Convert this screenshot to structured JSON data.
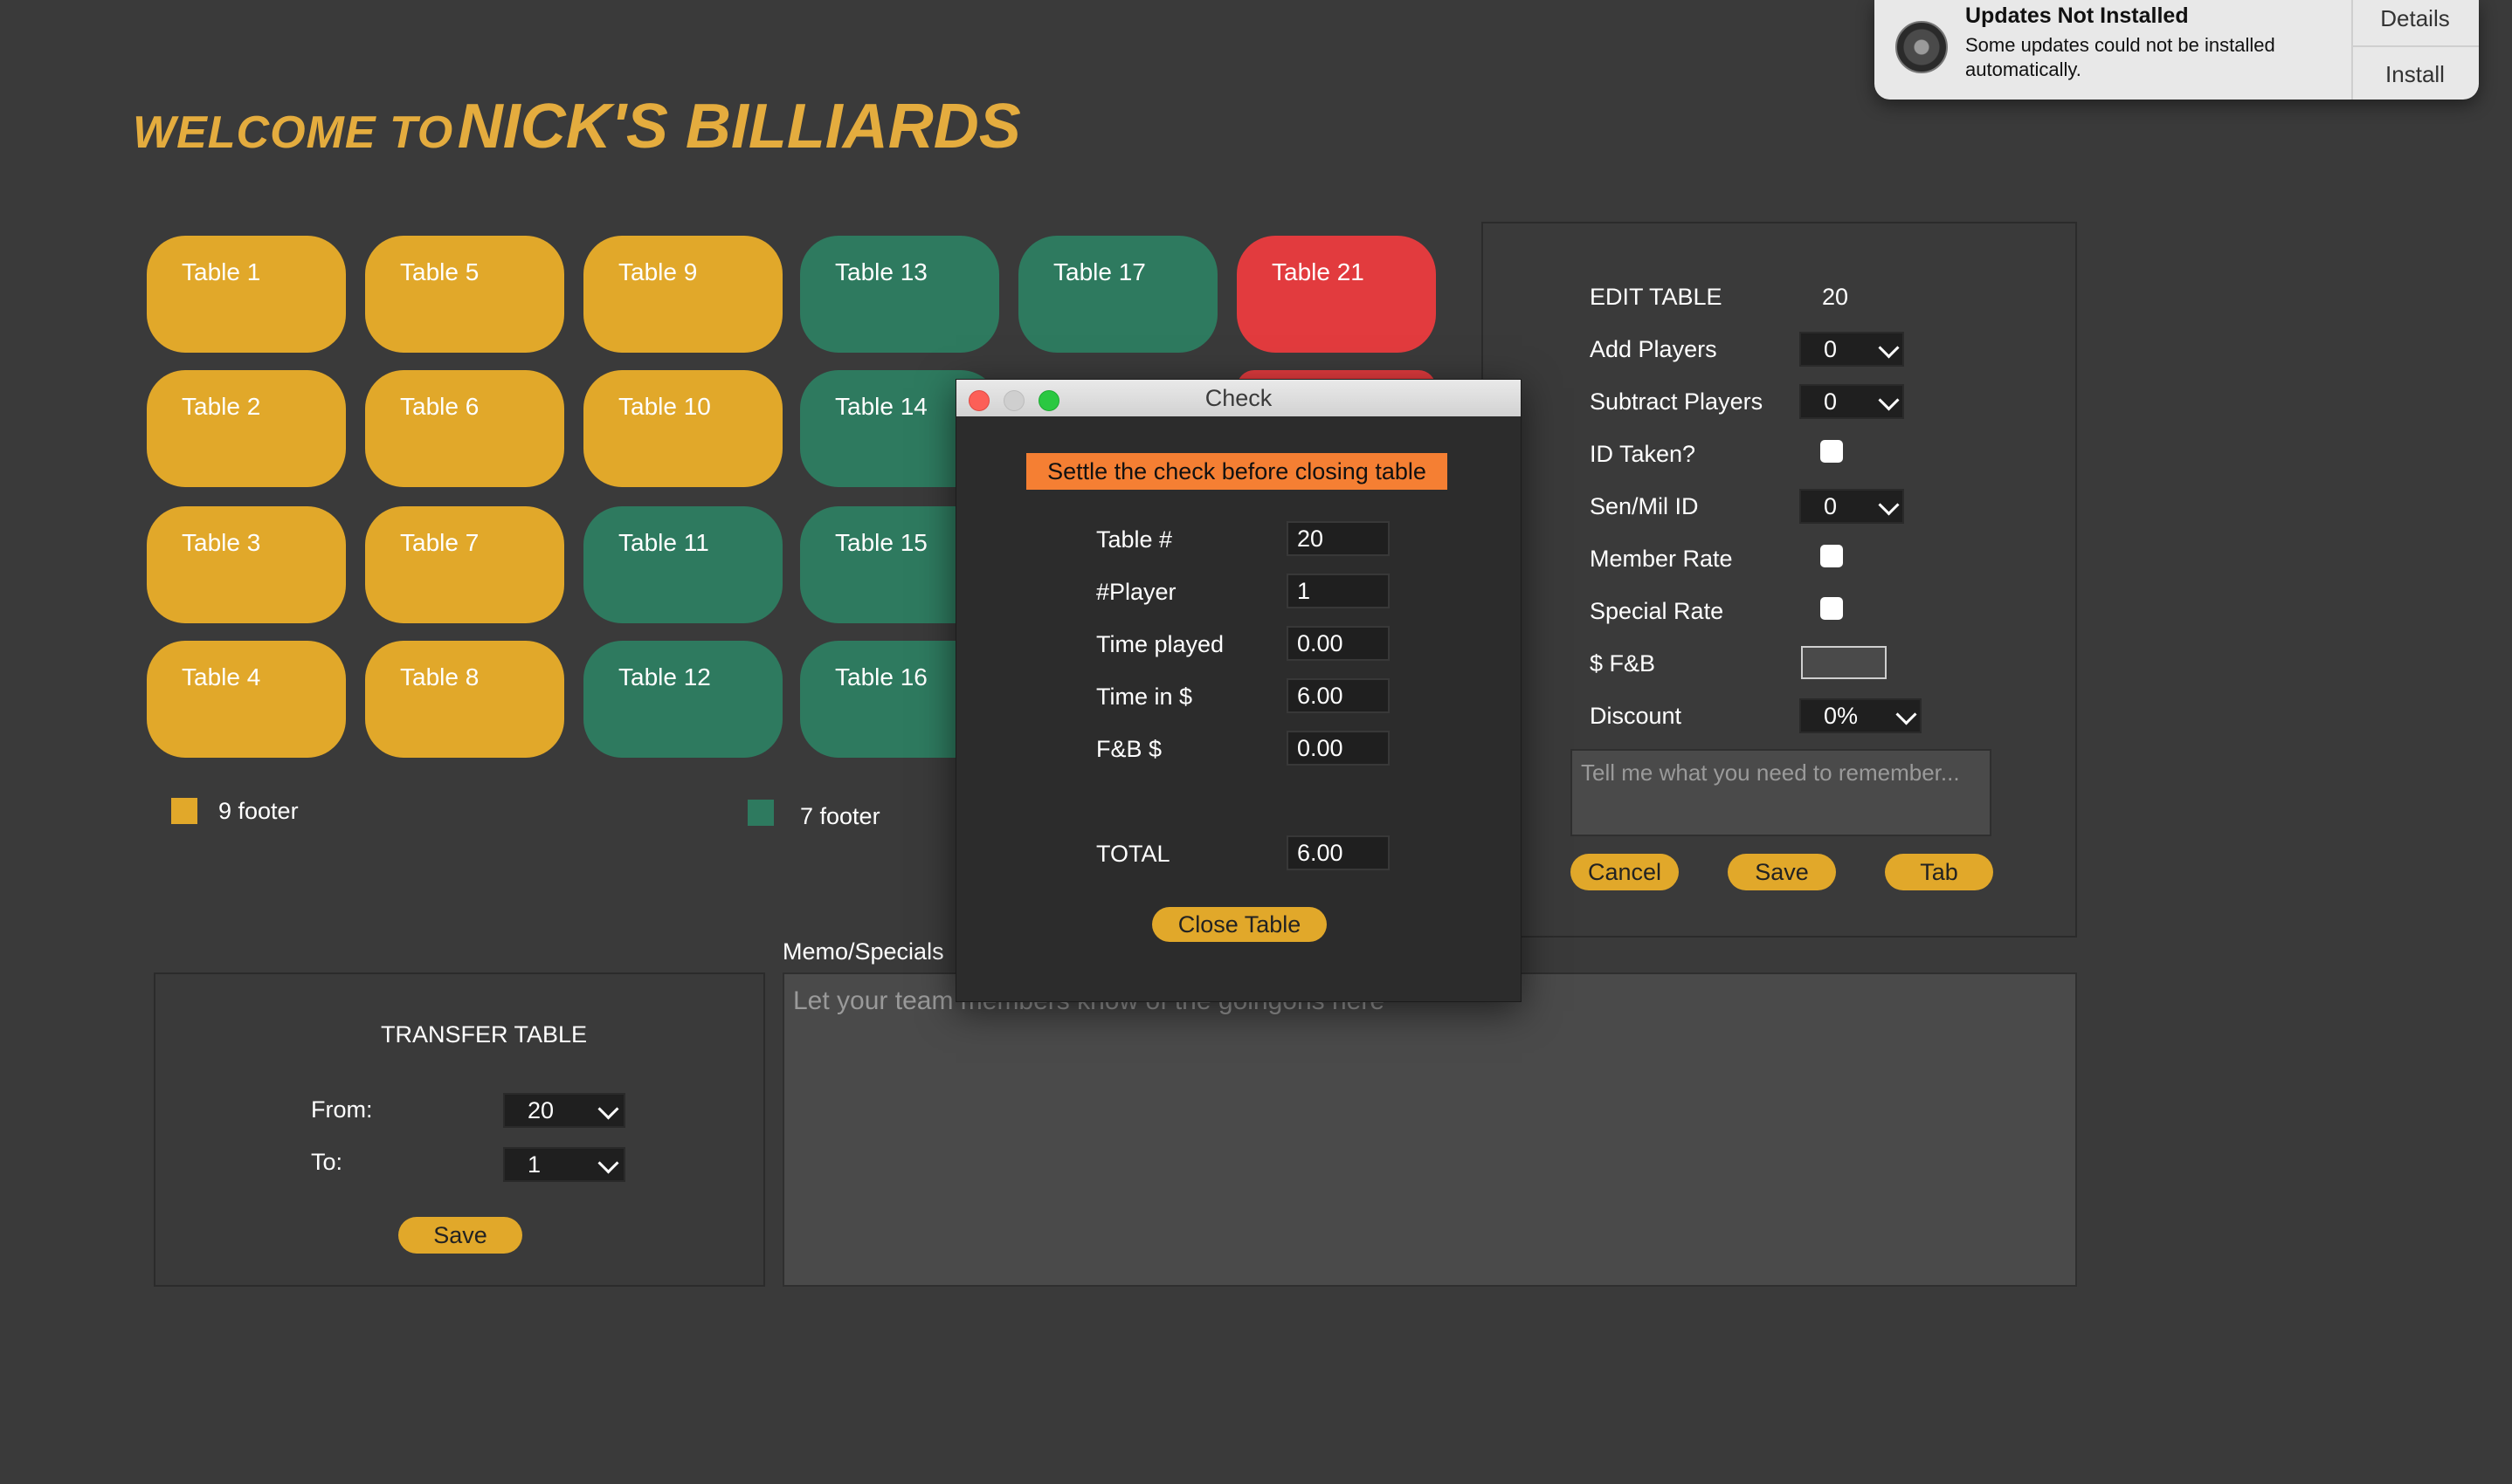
{
  "title": {
    "prefix": "WELCOME TO",
    "name": "NICK'S BILLIARDS"
  },
  "tables": [
    {
      "label": "Table 1",
      "status": "9ft"
    },
    {
      "label": "Table 2",
      "status": "9ft"
    },
    {
      "label": "Table 3",
      "status": "9ft"
    },
    {
      "label": "Table 4",
      "status": "9ft"
    },
    {
      "label": "Table 5",
      "status": "9ft"
    },
    {
      "label": "Table 6",
      "status": "9ft"
    },
    {
      "label": "Table 7",
      "status": "9ft"
    },
    {
      "label": "Table 8",
      "status": "9ft"
    },
    {
      "label": "Table 9",
      "status": "9ft"
    },
    {
      "label": "Table 10",
      "status": "9ft"
    },
    {
      "label": "Table 11",
      "status": "7ft"
    },
    {
      "label": "Table 12",
      "status": "7ft"
    },
    {
      "label": "Table 13",
      "status": "7ft"
    },
    {
      "label": "Table 14",
      "status": "7ft"
    },
    {
      "label": "Table 15",
      "status": "7ft"
    },
    {
      "label": "Table 16",
      "status": "7ft"
    },
    {
      "label": "Table 17",
      "status": "7ft"
    },
    {
      "label": "Table 21",
      "status": "occupied"
    }
  ],
  "colors": {
    "nine_footer": "#e1a82a",
    "seven_footer": "#2e7a5f",
    "occupied": "#e23b3e",
    "accent": "#e4ac3e",
    "warning": "#f57f33"
  },
  "legend": {
    "nine": "9 footer",
    "seven": "7 footer"
  },
  "edit_table": {
    "heading": "EDIT TABLE",
    "table_number": "20",
    "add_players_label": "Add Players",
    "add_players_value": "0",
    "subtract_players_label": "Subtract Players",
    "subtract_players_value": "0",
    "id_taken_label": "ID Taken?",
    "sen_mil_label": "Sen/Mil ID",
    "sen_mil_value": "0",
    "member_rate_label": "Member Rate",
    "special_rate_label": "Special Rate",
    "fb_label": "$ F&B",
    "fb_value": "",
    "discount_label": "Discount",
    "discount_value": "0%",
    "notes_placeholder": "Tell me what you need to remember...",
    "cancel": "Cancel",
    "save": "Save",
    "tab": "Tab"
  },
  "transfer": {
    "heading": "TRANSFER TABLE",
    "from_label": "From:",
    "from_value": "20",
    "to_label": "To:",
    "to_value": "1",
    "save": "Save"
  },
  "memo": {
    "label": "Memo/Specials",
    "placeholder": "Let your team members know of the goingons here"
  },
  "check_dialog": {
    "title": "Check",
    "warning": "Settle the check before closing table",
    "rows": [
      {
        "label": "Table #",
        "value": "20"
      },
      {
        "label": "#Player",
        "value": "1"
      },
      {
        "label": "Time played",
        "value": "0.00"
      },
      {
        "label": "Time in $",
        "value": "6.00"
      },
      {
        "label": "F&B $",
        "value": "0.00"
      }
    ],
    "total_label": "TOTAL",
    "total_value": "6.00",
    "close_button": "Close Table"
  },
  "notification": {
    "title": "Updates Not Installed",
    "body": "Some updates could not be installed automatically.",
    "details": "Details",
    "install": "Install"
  }
}
